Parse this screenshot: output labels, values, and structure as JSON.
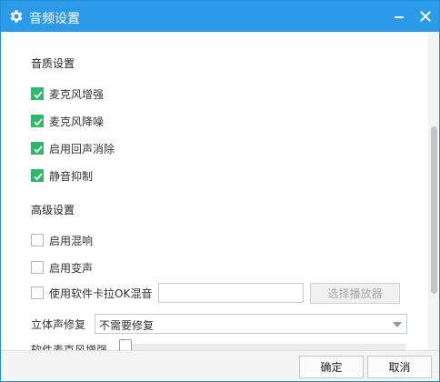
{
  "window": {
    "title": "音频设置",
    "title_icon": "gear-icon",
    "minimize_icon": "minimize-icon",
    "close_icon": "close-icon"
  },
  "quality": {
    "title": "音质设置",
    "options": [
      {
        "label": "麦克风增强",
        "checked": true
      },
      {
        "label": "麦克风降噪",
        "checked": true
      },
      {
        "label": "启用回声消除",
        "checked": true
      },
      {
        "label": "静音抑制",
        "checked": true
      }
    ]
  },
  "advanced": {
    "title": "高级设置",
    "options": [
      {
        "label": "启用混响",
        "checked": false
      },
      {
        "label": "启用变声",
        "checked": false
      },
      {
        "label": "使用软件卡拉OK混音",
        "checked": false
      }
    ],
    "karaoke_input_value": "",
    "select_player_label": "选择播放器"
  },
  "stereo": {
    "label": "立体声修复",
    "selected": "不需要修复"
  },
  "soft_mic": {
    "label": "软件麦克风增强"
  },
  "footer": {
    "ok_label": "确定",
    "cancel_label": "取消"
  },
  "colors": {
    "titlebar": "#2b9ae8",
    "check": "#2fb86a"
  }
}
